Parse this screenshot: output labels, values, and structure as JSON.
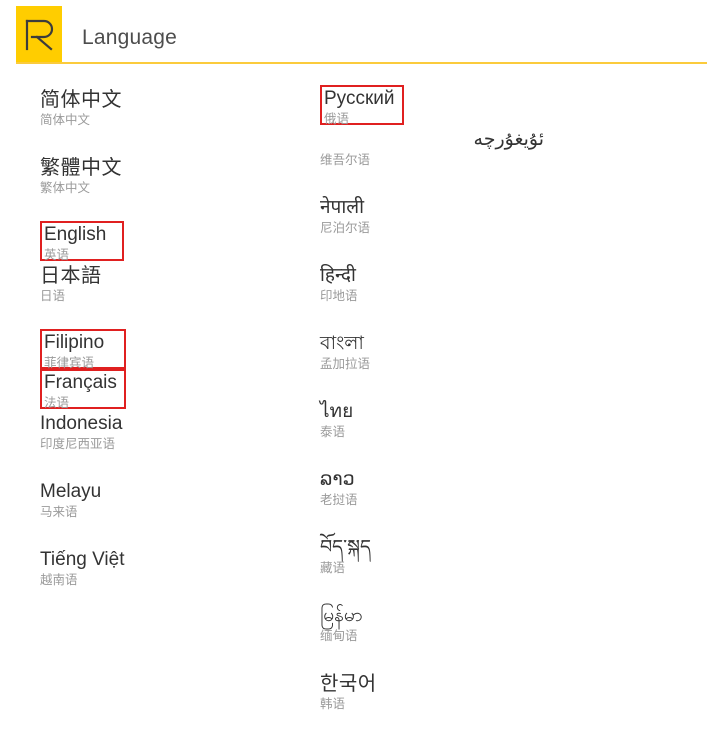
{
  "header": {
    "title": "Language",
    "logo_icon": "realme-r-logo-icon",
    "logo_background": "#FFCD00",
    "rule_color": "#FBCB3C",
    "title_color": "#4d4d4d"
  },
  "highlight": {
    "color": "#E02020",
    "items": [
      "English",
      "Filipino",
      "Français",
      "Русский"
    ]
  },
  "columns": {
    "left": [
      {
        "native": "简体中文",
        "sub": "简体中文",
        "cjk": true,
        "boxed": false
      },
      {
        "native": "繁體中文",
        "sub": "繁体中文",
        "cjk": true,
        "boxed": false
      },
      {
        "native": "English",
        "sub": "英语",
        "cjk": false,
        "boxed": true
      },
      {
        "native": "日本語",
        "sub": "日语",
        "cjk": true,
        "boxed": false
      },
      {
        "native": "Filipino",
        "sub": "菲律宾语",
        "cjk": false,
        "boxed": true
      },
      {
        "native": "Français",
        "sub": "法语",
        "cjk": false,
        "boxed": true
      },
      {
        "native": "Indonesia",
        "sub": "印度尼西亚语",
        "cjk": false,
        "boxed": false
      },
      {
        "native": "Melayu",
        "sub": "马来语",
        "cjk": false,
        "boxed": false
      },
      {
        "native": "Tiếng Việt",
        "sub": "越南语",
        "cjk": false,
        "boxed": false
      }
    ],
    "right": [
      {
        "native": "Русский",
        "sub": "俄语",
        "cjk": false,
        "boxed": true,
        "rtl": false
      },
      {
        "native": "ئۇيغۇرچە",
        "sub": "维吾尔语",
        "cjk": false,
        "boxed": false,
        "rtl": true
      },
      {
        "native": "नेपाली",
        "sub": "尼泊尔语",
        "cjk": false,
        "boxed": false,
        "rtl": false
      },
      {
        "native": "हिन्दी",
        "sub": "印地语",
        "cjk": false,
        "boxed": false,
        "rtl": false
      },
      {
        "native": "বাংলা",
        "sub": "孟加拉语",
        "cjk": false,
        "boxed": false,
        "rtl": false
      },
      {
        "native": "ไทย",
        "sub": "泰语",
        "cjk": false,
        "boxed": false,
        "rtl": false
      },
      {
        "native": "ລາວ",
        "sub": "老挝语",
        "cjk": false,
        "boxed": false,
        "rtl": false
      },
      {
        "native": "བོད་སྐད",
        "sub": "藏语",
        "cjk": false,
        "boxed": false,
        "rtl": false
      },
      {
        "native": "မြန်မာ",
        "sub": "缅甸语",
        "cjk": false,
        "boxed": false,
        "rtl": false
      },
      {
        "native": "한국어",
        "sub": "韩语",
        "cjk": true,
        "boxed": false,
        "rtl": false
      }
    ]
  }
}
